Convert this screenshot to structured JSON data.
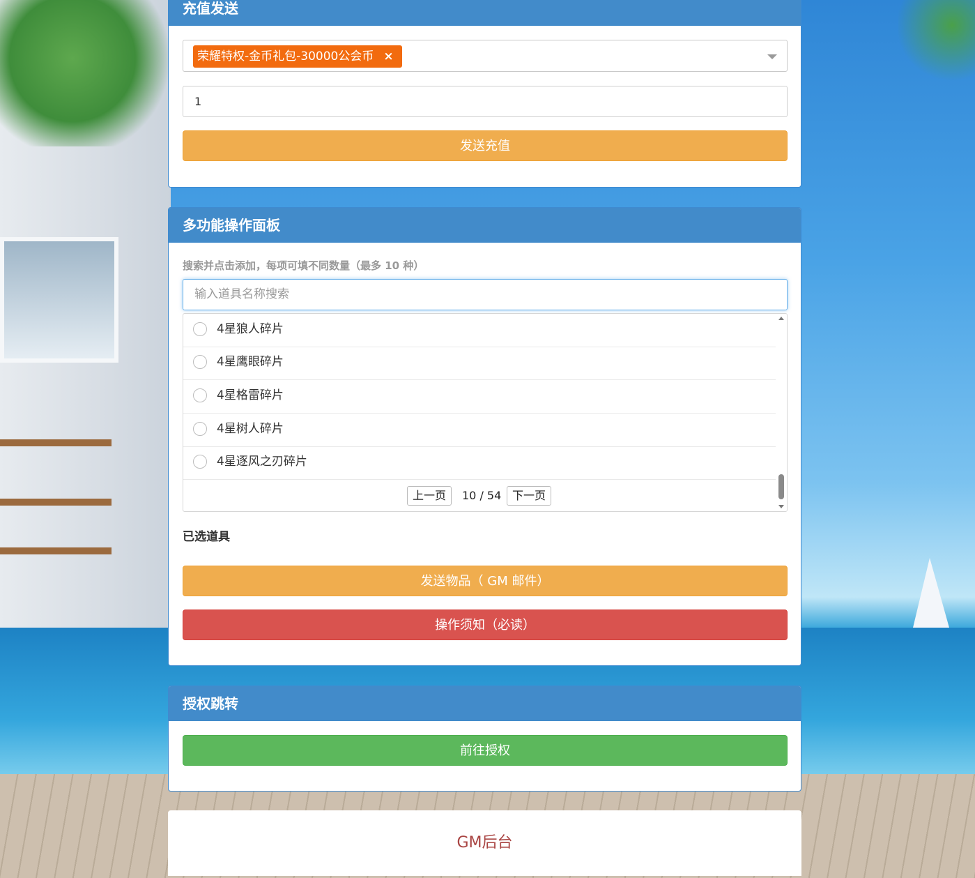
{
  "recharge": {
    "title": "充值发送",
    "selected_tag": "荣耀特权-金币礼包-30000公会币",
    "tag_remove": "×",
    "quantity_value": "1",
    "send_label": "发送充值"
  },
  "multi_panel": {
    "title": "多功能操作面板",
    "hint": "搜索并点击添加，每项可填不同数量（最多 10 种）",
    "search_placeholder": "输入道具名称搜索",
    "items": [
      {
        "label": "4星狼人碎片"
      },
      {
        "label": "4星鹰眼碎片"
      },
      {
        "label": "4星格雷碎片"
      },
      {
        "label": "4星树人碎片"
      },
      {
        "label": "4星逐风之刃碎片"
      }
    ],
    "pager": {
      "prev_label": "上一页",
      "page_info": "10 / 54",
      "next_label": "下一页"
    },
    "selected_title": "已选道具",
    "send_items_label": "发送物品（ GM 邮件）",
    "notice_label": "操作须知（必读）"
  },
  "auth": {
    "title": "授权跳转",
    "go_label": "前往授权"
  },
  "footer": {
    "label": "GM后台"
  },
  "colors": {
    "panel_header": "#428bca",
    "orange": "#f0ad4e",
    "red": "#d9534f",
    "green": "#5cb85c",
    "tag": "#f26b0f",
    "footer_text": "#a94442"
  }
}
